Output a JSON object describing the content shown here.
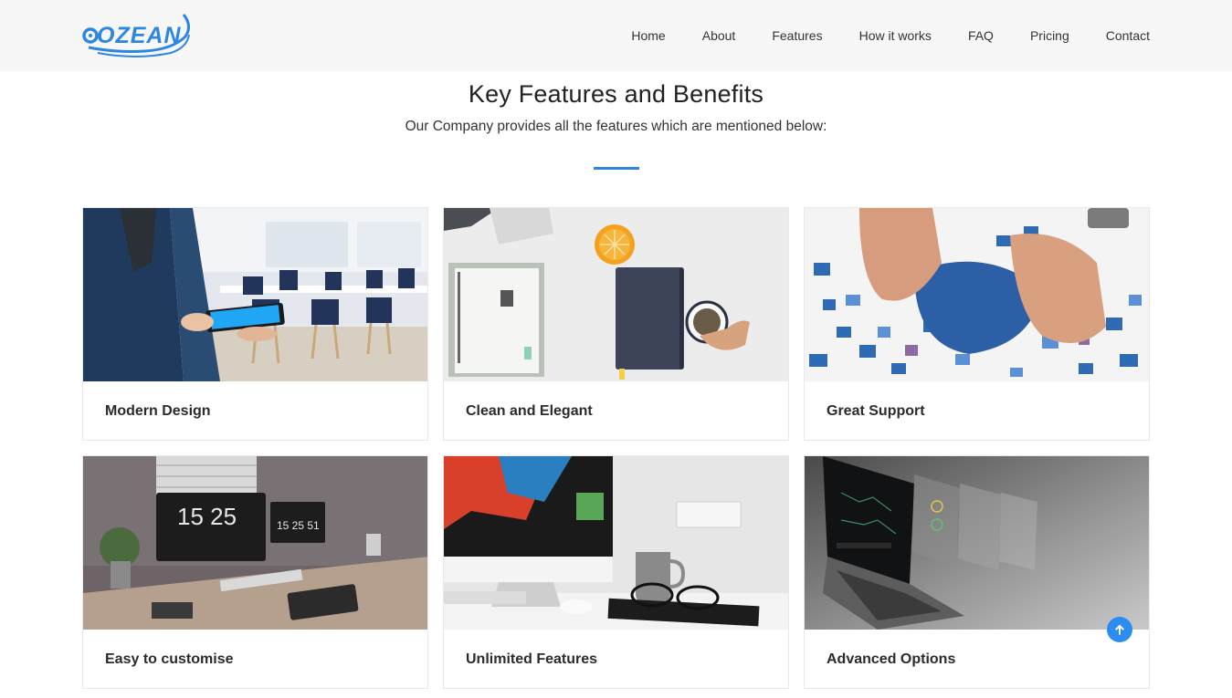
{
  "brand": {
    "logo_text": "OZEAN"
  },
  "nav": {
    "items": [
      "Home",
      "About",
      "Features",
      "How it works",
      "FAQ",
      "Pricing",
      "Contact"
    ]
  },
  "section": {
    "title": "Key Features and Benefits",
    "subtitle": "Our Company provides all the features which are mentioned below:"
  },
  "cards": [
    {
      "title": "Modern Design"
    },
    {
      "title": "Clean and Elegant"
    },
    {
      "title": "Great Support"
    },
    {
      "title": "Easy to customise"
    },
    {
      "title": "Unlimited Features"
    },
    {
      "title": "Advanced Options"
    }
  ],
  "colors": {
    "accent": "#2d87e2",
    "navbar_bg": "#f7f7f7",
    "scroll_button": "#2d8cf0"
  },
  "icons": {
    "scroll_top": "arrow-up-icon"
  }
}
